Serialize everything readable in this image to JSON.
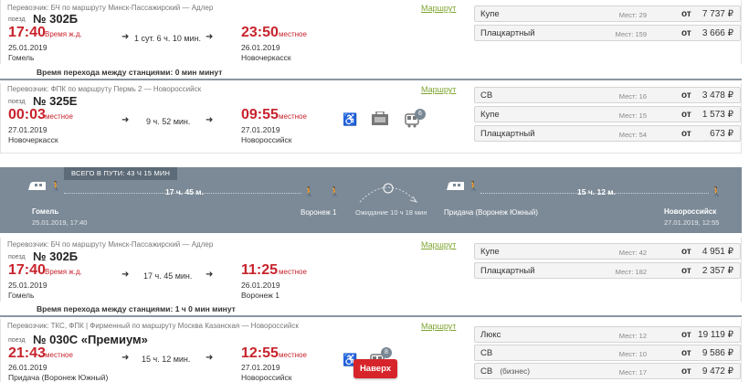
{
  "trip1": {
    "carrier": "Перевозчик: БЧ   по маршруту Минск-Пассажирский — Адлер",
    "route_link": "Маршрут",
    "poezd_label": "поезд",
    "train": "№ 302Б",
    "dep_time": "17:40",
    "dep_note": "Время ж.д.",
    "dep_date": "25.01.2019",
    "dep_station": "Гомель",
    "duration": "1 сут. 6 ч. 10 мин.",
    "arr_time": "23:50",
    "arr_note": "местное",
    "arr_date": "26.01.2019",
    "arr_station": "Новочеркасск",
    "seats": [
      {
        "class": "Купе",
        "places": "Мест: 29",
        "ot": "от",
        "price": "7 737 ₽"
      },
      {
        "class": "Плацкартный",
        "places": "Мест: 159",
        "ot": "от",
        "price": "3 666 ₽"
      }
    ]
  },
  "transfer1": "Время перехода между станциями: 0 мин минут",
  "trip2": {
    "carrier": "Перевозчик: ФПК   по маршруту Пермь 2 — Новороссийск",
    "route_link": "Маршрут",
    "poezd_label": "поезд",
    "train": "№ 325Е",
    "dep_time": "00:03",
    "dep_note": "местное",
    "dep_date": "27.01.2019",
    "dep_station": "Новочеркасск",
    "duration": "9 ч. 52 мин.",
    "arr_time": "09:55",
    "arr_note": "местное",
    "arr_date": "27.01.2019",
    "arr_station": "Новороссийск",
    "badge": "6",
    "seats": [
      {
        "class": "СВ",
        "places": "Мест: 16",
        "ot": "от",
        "price": "3 478 ₽"
      },
      {
        "class": "Купе",
        "places": "Мест: 15",
        "ot": "от",
        "price": "1 573 ₽"
      },
      {
        "class": "Плацкартный",
        "places": "Мест: 54",
        "ot": "от",
        "price": "673 ₽"
      }
    ]
  },
  "banner": {
    "total": "ВСЕГО В ПУТИ: 43 Ч 15 МИН",
    "seg1": "17 ч. 45 м.",
    "seg2": "15 ч. 12 м.",
    "from": "Гомель",
    "from_dt": "25.01.2019, 17:40",
    "mid1": "Воронеж 1",
    "wait": "Ожидание 10 ч 18 мин",
    "mid2": "Придача (Воронеж Южный)",
    "to": "Новороссийск",
    "to_dt": "27.01.2019, 12:55"
  },
  "trip3": {
    "carrier": "Перевозчик: БЧ   по маршруту Минск-Пассажирский — Адлер",
    "route_link": "Маршрут",
    "poezd_label": "поезд",
    "train": "№ 302Б",
    "dep_time": "17:40",
    "dep_note": "Время ж.д.",
    "dep_date": "25.01.2019",
    "dep_station": "Гомель",
    "duration": "17 ч. 45 мин.",
    "arr_time": "11:25",
    "arr_note": "местное",
    "arr_date": "26.01.2019",
    "arr_station": "Воронеж 1",
    "seats": [
      {
        "class": "Купе",
        "places": "Мест: 42",
        "ot": "от",
        "price": "4 951 ₽"
      },
      {
        "class": "Плацкартный",
        "places": "Мест: 182",
        "ot": "от",
        "price": "2 357 ₽"
      }
    ]
  },
  "transfer2": "Время перехода между станциями: 1 ч 0 мин минут",
  "trip4": {
    "carrier": "Перевозчик: ТКС, ФПК | Фирменный   по маршруту Москва Казанская — Новороссийск",
    "route_link": "Маршрут",
    "poezd_label": "поезд",
    "train": "№ 030С «Премиум»",
    "dep_time": "21:43",
    "dep_note": "местное",
    "dep_date": "26.01.2019",
    "dep_station": "Придача (Воронеж Южный)",
    "duration": "15 ч. 12 мин.",
    "arr_time": "12:55",
    "arr_note": "местное",
    "arr_date": "27.01.2019",
    "arr_station": "Новороссийск",
    "badge": "8",
    "seats": [
      {
        "class": "Люкс",
        "sub": "",
        "places": "Мест: 12",
        "ot": "от",
        "price": "19 119 ₽"
      },
      {
        "class": "СВ",
        "sub": "",
        "places": "Мест: 10",
        "ot": "от",
        "price": "9 586 ₽"
      },
      {
        "class": "СВ",
        "sub": "(бизнес)",
        "places": "Мест: 17",
        "ot": "от",
        "price": "9 472 ₽"
      }
    ]
  },
  "up_button": "Наверх",
  "colors": {
    "accent_red": "#c8232c",
    "link_green": "#7ea42e",
    "banner": "#7c8a97"
  }
}
